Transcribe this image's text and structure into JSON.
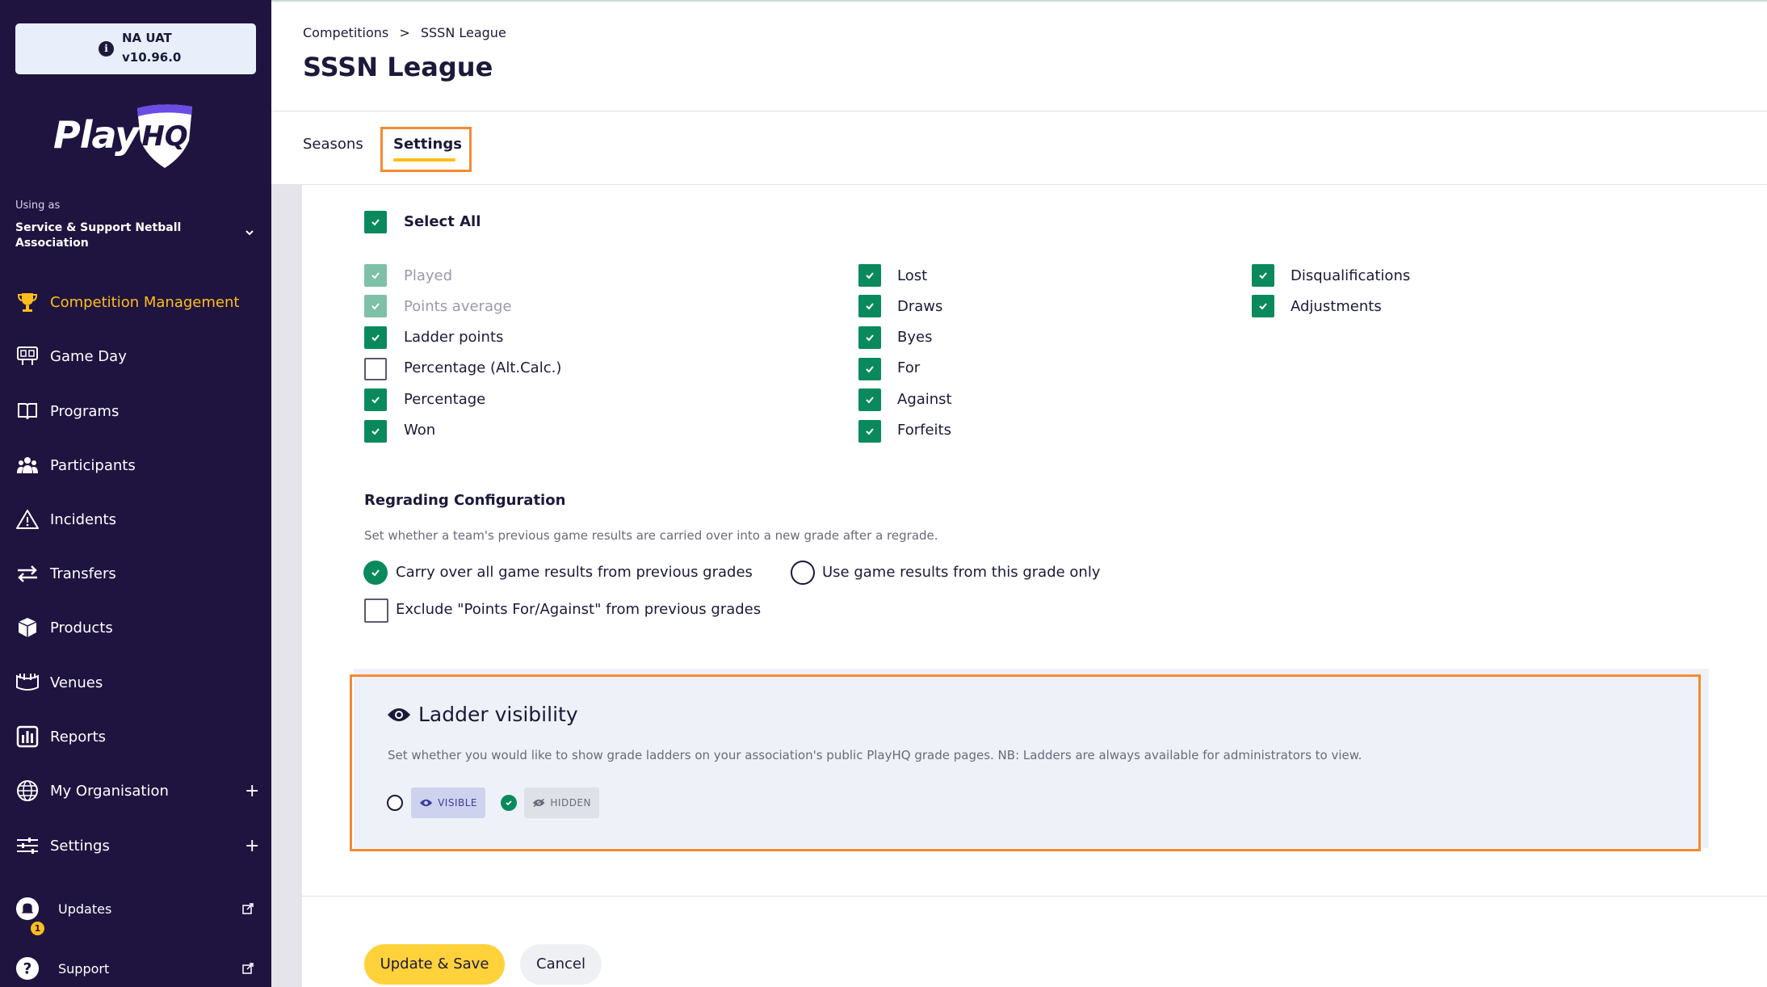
{
  "environment": {
    "name": "NA UAT",
    "version": "v10.96.0",
    "icon": "info-icon"
  },
  "brand": {
    "logo_text": "Play",
    "logo_mark": "HQ"
  },
  "account": {
    "using_as_label": "Using as",
    "organisation": "Service & Support Netball Association"
  },
  "sidebar": {
    "items": [
      {
        "label": "Competition Management",
        "icon": "trophy-icon",
        "active": true
      },
      {
        "label": "Game Day",
        "icon": "scoreboard-icon"
      },
      {
        "label": "Programs",
        "icon": "book-icon"
      },
      {
        "label": "Participants",
        "icon": "people-icon"
      },
      {
        "label": "Incidents",
        "icon": "warning-icon"
      },
      {
        "label": "Transfers",
        "icon": "transfer-arrows-icon"
      },
      {
        "label": "Products",
        "icon": "box-icon"
      },
      {
        "label": "Venues",
        "icon": "stadium-icon"
      },
      {
        "label": "Reports",
        "icon": "bar-chart-icon"
      },
      {
        "label": "My Organisation",
        "icon": "globe-icon",
        "expand": "+"
      },
      {
        "label": "Settings",
        "icon": "sliders-icon",
        "expand": "+"
      }
    ],
    "footer_items": [
      {
        "label": "Updates",
        "icon": "bell-icon",
        "badge": "1"
      },
      {
        "label": "Support",
        "icon": "question-icon"
      }
    ]
  },
  "breadcrumb": {
    "parent": "Competitions",
    "separator": ">",
    "current": "SSSN League"
  },
  "page_title": "SSSN League",
  "tabs": [
    {
      "label": "Seasons"
    },
    {
      "label": "Settings",
      "active": true
    }
  ],
  "ladder_columns": {
    "select_all": "Select All",
    "col1": [
      {
        "label": "Played",
        "state": "checked-disabled"
      },
      {
        "label": "Points average",
        "state": "checked-disabled"
      },
      {
        "label": "Ladder points",
        "state": "checked"
      },
      {
        "label": "Percentage (Alt.Calc.)",
        "state": "unchecked"
      },
      {
        "label": "Percentage",
        "state": "checked"
      },
      {
        "label": "Won",
        "state": "checked"
      }
    ],
    "col2": [
      {
        "label": "Lost",
        "state": "checked"
      },
      {
        "label": "Draws",
        "state": "checked"
      },
      {
        "label": "Byes",
        "state": "checked"
      },
      {
        "label": "For",
        "state": "checked"
      },
      {
        "label": "Against",
        "state": "checked"
      },
      {
        "label": "Forfeits",
        "state": "checked"
      }
    ],
    "col3": [
      {
        "label": "Disqualifications",
        "state": "checked"
      },
      {
        "label": "Adjustments",
        "state": "checked"
      }
    ]
  },
  "regrading": {
    "title": "Regrading Configuration",
    "description": "Set whether a team's previous game results are carried over into a new grade after a regrade.",
    "option_carry": "Carry over all game results from previous grades",
    "option_this_grade": "Use game results from this grade only",
    "exclude_label": "Exclude \"Points For/Against\" from previous grades"
  },
  "ladder_visibility": {
    "title": "Ladder visibility",
    "description": "Set whether you would like to show grade ladders on your association's public PlayHQ grade pages. NB: Ladders are always available for administrators to view.",
    "visible_label": "VISIBLE",
    "hidden_label": "HIDDEN",
    "selected": "HIDDEN"
  },
  "actions": {
    "save": "Update & Save",
    "cancel": "Cancel"
  },
  "colors": {
    "sidebar_bg": "#1f1440",
    "accent_yellow": "#ffbe1a",
    "check_green": "#0a8a5c",
    "highlight_orange": "#f58a32"
  }
}
